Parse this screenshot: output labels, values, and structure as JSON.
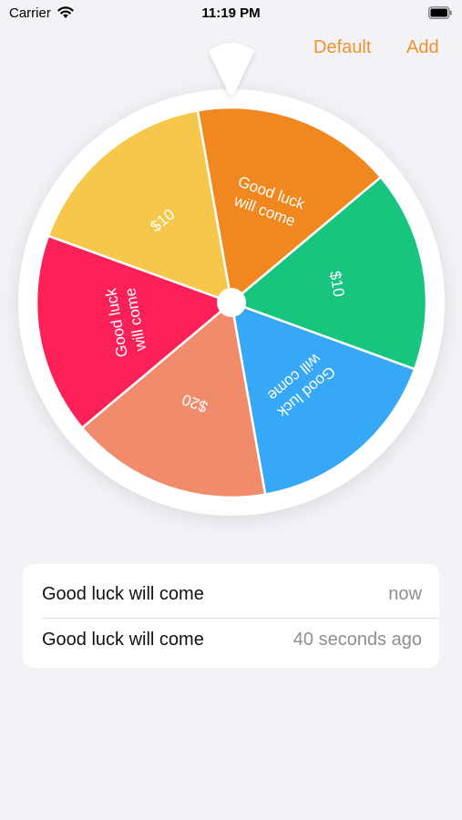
{
  "status_bar": {
    "carrier": "Carrier",
    "time": "11:19 PM",
    "icons": [
      "wifi-icon",
      "battery-icon"
    ]
  },
  "nav": {
    "default_label": "Default",
    "add_label": "Add",
    "accent_color": "#f0932d"
  },
  "wheel": {
    "pointer_icon": "wheel-pointer-icon",
    "center_icon": "hub-icon",
    "segments": [
      {
        "label": "Good luck will come",
        "lines": [
          "Good luck",
          "will come"
        ],
        "color": "#f0881f"
      },
      {
        "label": "$10",
        "lines": [
          "$10"
        ],
        "color": "#17c57f"
      },
      {
        "label": "Good luck will come",
        "lines": [
          "Good luck",
          "will come"
        ],
        "color": "#36a8f6"
      },
      {
        "label": "$20",
        "lines": [
          "$20"
        ],
        "color": "#f08c6c"
      },
      {
        "label": "Good luck will come",
        "lines": [
          "Good luck",
          "will come"
        ],
        "color": "#fc2058"
      },
      {
        "label": "$10",
        "lines": [
          "$10"
        ],
        "color": "#f5c84c"
      }
    ]
  },
  "history": [
    {
      "title": "Good luck will come",
      "time": "now"
    },
    {
      "title": "Good luck will come",
      "time": "40 seconds ago"
    }
  ]
}
